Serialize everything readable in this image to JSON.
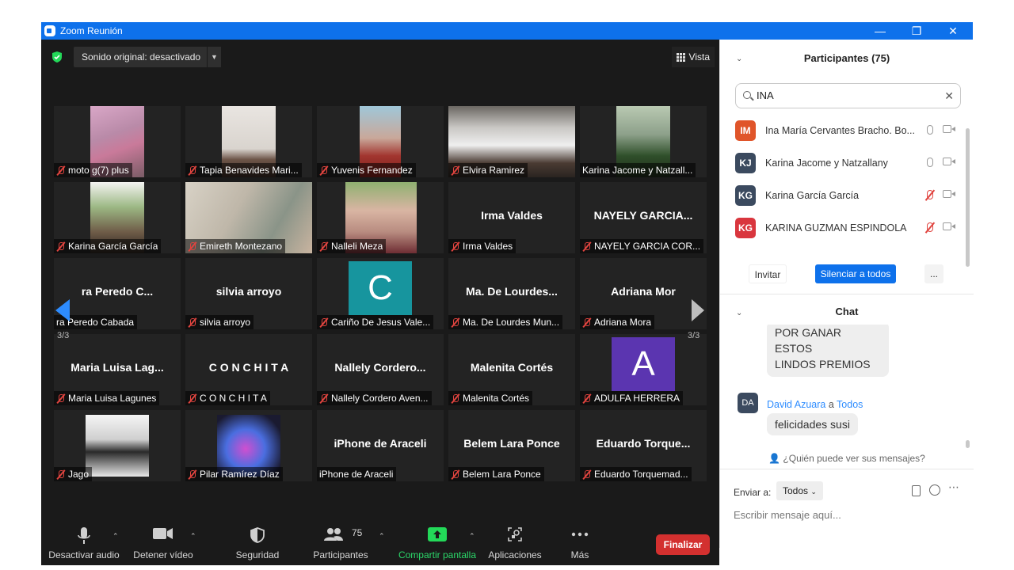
{
  "window": {
    "title": "Zoom Reunión"
  },
  "meeting": {
    "sound_label": "Sonido original: desactivado",
    "view_label": "Vista",
    "page_left": "3/3",
    "page_right": "3/3"
  },
  "tiles": [
    {
      "name": "moto g(7) plus",
      "big": "",
      "muted": true
    },
    {
      "name": "Tapia Benavides Mari...",
      "big": "",
      "muted": true
    },
    {
      "name": "Yuvenis Fernandez",
      "big": "",
      "muted": true
    },
    {
      "name": "Elvira Ramirez",
      "big": "",
      "muted": true
    },
    {
      "name": "Karina Jacome y Natzall...",
      "big": "",
      "muted": false
    },
    {
      "name": "Karina García García",
      "big": "",
      "muted": true
    },
    {
      "name": "Emireth Montezano",
      "big": "",
      "muted": true
    },
    {
      "name": "Nalleli Meza",
      "big": "",
      "muted": true
    },
    {
      "name": "Irma Valdes",
      "big": "Irma Valdes",
      "muted": true
    },
    {
      "name": "NAYELY GARCIA COR...",
      "big": "NAYELY GARCIA...",
      "muted": true
    },
    {
      "name": "ra Peredo Cabada",
      "big": "ra Peredo C...",
      "muted": false
    },
    {
      "name": "silvia arroyo",
      "big": "silvia arroyo",
      "muted": true
    },
    {
      "name": "Cariño De Jesus Vale...",
      "big": "",
      "muted": true,
      "letter": "C"
    },
    {
      "name": "Ma. De Lourdes Mun...",
      "big": "Ma. De Lourdes...",
      "muted": true
    },
    {
      "name": "Adriana Mora",
      "big": "Adriana Mor",
      "muted": true
    },
    {
      "name": "Maria Luisa Lagunes",
      "big": "Maria Luisa Lag...",
      "muted": true
    },
    {
      "name": "C O N C H I T A",
      "big": "C O N C H I T A",
      "muted": true
    },
    {
      "name": "Nallely Cordero Aven...",
      "big": "Nallely  Cordero...",
      "muted": true
    },
    {
      "name": "Malenita Cortés",
      "big": "Malenita Cortés",
      "muted": true
    },
    {
      "name": "ADULFA HERRERA",
      "big": "",
      "muted": true,
      "letter": "A"
    },
    {
      "name": "Jago",
      "big": "",
      "muted": true
    },
    {
      "name": "Pilar Ramírez Díaz",
      "big": "",
      "muted": true
    },
    {
      "name": "iPhone de Araceli",
      "big": "iPhone de Araceli",
      "muted": false
    },
    {
      "name": "Belem Lara Ponce",
      "big": "Belem Lara Ponce",
      "muted": true
    },
    {
      "name": "Eduardo Torquemad...",
      "big": "Eduardo  Torque...",
      "muted": true
    }
  ],
  "toolbar": {
    "audio": "Desactivar audio",
    "video": "Detener vídeo",
    "security": "Seguridad",
    "participants": "Participantes",
    "participants_count": "75",
    "share": "Compartir pantalla",
    "apps": "Aplicaciones",
    "more": "Más",
    "end": "Finalizar"
  },
  "participants_panel": {
    "title": "Participantes (75)",
    "search_value": "INA",
    "people": [
      {
        "initials": "IM",
        "name": "Ina María Cervantes Bracho. Bo...",
        "color": "#e0552a",
        "mic_off": false
      },
      {
        "initials": "KJ",
        "name": "Karina Jacome y Natzallany",
        "color": "#3b4a5f",
        "mic_off": false
      },
      {
        "initials": "KG",
        "name": "Karina García García",
        "color": "#3b4a5f",
        "mic_off": true
      },
      {
        "initials": "KG",
        "name": "KARINA GUZMAN ESPINDOLA",
        "color": "#d9363e",
        "mic_off": true
      }
    ],
    "invite": "Invitar",
    "mute_all": "Silenciar a todos",
    "more": "..."
  },
  "chat": {
    "title": "Chat",
    "prev_message": "POR GANAR ESTOS\nLINDOS PREMIOS",
    "sender": "David Azuara",
    "to_word": "a",
    "recipient": "Todos",
    "sender_initials": "DA",
    "message": "felicidades susi",
    "who_can_see": "¿Quién puede ver sus mensajes?",
    "send_to_label": "Enviar a:",
    "send_to_value": "Todos",
    "placeholder": "Escribir mensaje aquí..."
  }
}
